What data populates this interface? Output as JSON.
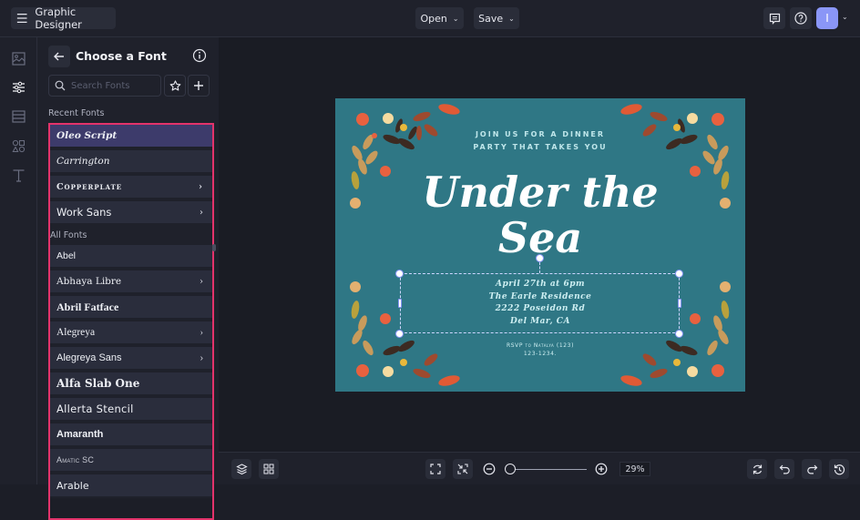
{
  "topbar": {
    "app_title": "Graphic Designer",
    "open_label": "Open",
    "save_label": "Save",
    "avatar_initial": "I",
    "icons": [
      "hamburger-menu-icon",
      "comment-icon",
      "help-icon",
      "chevron-down-icon"
    ]
  },
  "rail": {
    "items": [
      "image-icon",
      "sliders-icon",
      "background-icon",
      "shapes-icon",
      "text-icon"
    ],
    "active": "sliders-icon"
  },
  "panel": {
    "title": "Choose a Font",
    "search_placeholder": "Search Fonts",
    "search_value": "",
    "recent_label": "Recent Fonts",
    "all_label": "All Fonts",
    "recent_fonts": [
      {
        "name": "Oleo Script",
        "has_variants": false,
        "selected": true
      },
      {
        "name": "Carrington",
        "has_variants": false,
        "selected": false
      },
      {
        "name": "Copperplate",
        "has_variants": true,
        "selected": false
      },
      {
        "name": "Work Sans",
        "has_variants": true,
        "selected": false
      }
    ],
    "all_fonts": [
      {
        "name": "Abel",
        "has_variants": false
      },
      {
        "name": "Abhaya Libre",
        "has_variants": true
      },
      {
        "name": "Abril Fatface",
        "has_variants": false
      },
      {
        "name": "Alegreya",
        "has_variants": true
      },
      {
        "name": "Alegreya Sans",
        "has_variants": true
      },
      {
        "name": "Alfa Slab One",
        "has_variants": false
      },
      {
        "name": "Allerta Stencil",
        "has_variants": false
      },
      {
        "name": "Amaranth",
        "has_variants": false
      },
      {
        "name": "Amatic SC",
        "has_variants": false
      },
      {
        "name": "Arable",
        "has_variants": false
      }
    ],
    "arrow_glyph": "›"
  },
  "canvas": {
    "background_color": "#2f7785",
    "intro_line1": "JOIN US FOR A DINNER",
    "intro_line2": "PARTY THAT TAKES YOU",
    "title_line1": "Under the",
    "title_line2": "Sea",
    "details": [
      "April 27th at 6pm",
      "The Earle Residence",
      "2222 Poseidon Rd",
      "Del Mar, CA"
    ],
    "rsvp_line1": "RSVP to Natalya (123)",
    "rsvp_line2": "123-1234."
  },
  "bottombar": {
    "zoom_percent": "29%",
    "zoom_level": 0.29,
    "left_icons": [
      "layers-icon",
      "grid-icon"
    ],
    "center_icons": [
      "fit-screen-icon",
      "shrink-icon",
      "zoom-out-icon",
      "zoom-in-icon"
    ],
    "right_icons": [
      "refresh-icon",
      "undo-icon",
      "redo-icon",
      "history-icon"
    ]
  },
  "colors": {
    "accent": "#8a96f7",
    "highlight_border": "#e3336b",
    "selected_font_bg": "#3d3b6b"
  }
}
